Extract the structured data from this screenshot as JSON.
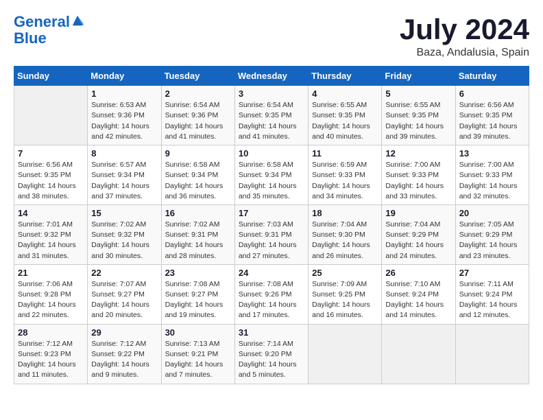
{
  "logo": {
    "line1": "General",
    "line2": "Blue"
  },
  "title": "July 2024",
  "subtitle": "Baza, Andalusia, Spain",
  "weekdays": [
    "Sunday",
    "Monday",
    "Tuesday",
    "Wednesday",
    "Thursday",
    "Friday",
    "Saturday"
  ],
  "weeks": [
    [
      {
        "day": "",
        "sunrise": "",
        "sunset": "",
        "daylight": ""
      },
      {
        "day": "1",
        "sunrise": "Sunrise: 6:53 AM",
        "sunset": "Sunset: 9:36 PM",
        "daylight": "Daylight: 14 hours and 42 minutes."
      },
      {
        "day": "2",
        "sunrise": "Sunrise: 6:54 AM",
        "sunset": "Sunset: 9:36 PM",
        "daylight": "Daylight: 14 hours and 41 minutes."
      },
      {
        "day": "3",
        "sunrise": "Sunrise: 6:54 AM",
        "sunset": "Sunset: 9:35 PM",
        "daylight": "Daylight: 14 hours and 41 minutes."
      },
      {
        "day": "4",
        "sunrise": "Sunrise: 6:55 AM",
        "sunset": "Sunset: 9:35 PM",
        "daylight": "Daylight: 14 hours and 40 minutes."
      },
      {
        "day": "5",
        "sunrise": "Sunrise: 6:55 AM",
        "sunset": "Sunset: 9:35 PM",
        "daylight": "Daylight: 14 hours and 39 minutes."
      },
      {
        "day": "6",
        "sunrise": "Sunrise: 6:56 AM",
        "sunset": "Sunset: 9:35 PM",
        "daylight": "Daylight: 14 hours and 39 minutes."
      }
    ],
    [
      {
        "day": "7",
        "sunrise": "Sunrise: 6:56 AM",
        "sunset": "Sunset: 9:35 PM",
        "daylight": "Daylight: 14 hours and 38 minutes."
      },
      {
        "day": "8",
        "sunrise": "Sunrise: 6:57 AM",
        "sunset": "Sunset: 9:34 PM",
        "daylight": "Daylight: 14 hours and 37 minutes."
      },
      {
        "day": "9",
        "sunrise": "Sunrise: 6:58 AM",
        "sunset": "Sunset: 9:34 PM",
        "daylight": "Daylight: 14 hours and 36 minutes."
      },
      {
        "day": "10",
        "sunrise": "Sunrise: 6:58 AM",
        "sunset": "Sunset: 9:34 PM",
        "daylight": "Daylight: 14 hours and 35 minutes."
      },
      {
        "day": "11",
        "sunrise": "Sunrise: 6:59 AM",
        "sunset": "Sunset: 9:33 PM",
        "daylight": "Daylight: 14 hours and 34 minutes."
      },
      {
        "day": "12",
        "sunrise": "Sunrise: 7:00 AM",
        "sunset": "Sunset: 9:33 PM",
        "daylight": "Daylight: 14 hours and 33 minutes."
      },
      {
        "day": "13",
        "sunrise": "Sunrise: 7:00 AM",
        "sunset": "Sunset: 9:33 PM",
        "daylight": "Daylight: 14 hours and 32 minutes."
      }
    ],
    [
      {
        "day": "14",
        "sunrise": "Sunrise: 7:01 AM",
        "sunset": "Sunset: 9:32 PM",
        "daylight": "Daylight: 14 hours and 31 minutes."
      },
      {
        "day": "15",
        "sunrise": "Sunrise: 7:02 AM",
        "sunset": "Sunset: 9:32 PM",
        "daylight": "Daylight: 14 hours and 30 minutes."
      },
      {
        "day": "16",
        "sunrise": "Sunrise: 7:02 AM",
        "sunset": "Sunset: 9:31 PM",
        "daylight": "Daylight: 14 hours and 28 minutes."
      },
      {
        "day": "17",
        "sunrise": "Sunrise: 7:03 AM",
        "sunset": "Sunset: 9:31 PM",
        "daylight": "Daylight: 14 hours and 27 minutes."
      },
      {
        "day": "18",
        "sunrise": "Sunrise: 7:04 AM",
        "sunset": "Sunset: 9:30 PM",
        "daylight": "Daylight: 14 hours and 26 minutes."
      },
      {
        "day": "19",
        "sunrise": "Sunrise: 7:04 AM",
        "sunset": "Sunset: 9:29 PM",
        "daylight": "Daylight: 14 hours and 24 minutes."
      },
      {
        "day": "20",
        "sunrise": "Sunrise: 7:05 AM",
        "sunset": "Sunset: 9:29 PM",
        "daylight": "Daylight: 14 hours and 23 minutes."
      }
    ],
    [
      {
        "day": "21",
        "sunrise": "Sunrise: 7:06 AM",
        "sunset": "Sunset: 9:28 PM",
        "daylight": "Daylight: 14 hours and 22 minutes."
      },
      {
        "day": "22",
        "sunrise": "Sunrise: 7:07 AM",
        "sunset": "Sunset: 9:27 PM",
        "daylight": "Daylight: 14 hours and 20 minutes."
      },
      {
        "day": "23",
        "sunrise": "Sunrise: 7:08 AM",
        "sunset": "Sunset: 9:27 PM",
        "daylight": "Daylight: 14 hours and 19 minutes."
      },
      {
        "day": "24",
        "sunrise": "Sunrise: 7:08 AM",
        "sunset": "Sunset: 9:26 PM",
        "daylight": "Daylight: 14 hours and 17 minutes."
      },
      {
        "day": "25",
        "sunrise": "Sunrise: 7:09 AM",
        "sunset": "Sunset: 9:25 PM",
        "daylight": "Daylight: 14 hours and 16 minutes."
      },
      {
        "day": "26",
        "sunrise": "Sunrise: 7:10 AM",
        "sunset": "Sunset: 9:24 PM",
        "daylight": "Daylight: 14 hours and 14 minutes."
      },
      {
        "day": "27",
        "sunrise": "Sunrise: 7:11 AM",
        "sunset": "Sunset: 9:24 PM",
        "daylight": "Daylight: 14 hours and 12 minutes."
      }
    ],
    [
      {
        "day": "28",
        "sunrise": "Sunrise: 7:12 AM",
        "sunset": "Sunset: 9:23 PM",
        "daylight": "Daylight: 14 hours and 11 minutes."
      },
      {
        "day": "29",
        "sunrise": "Sunrise: 7:12 AM",
        "sunset": "Sunset: 9:22 PM",
        "daylight": "Daylight: 14 hours and 9 minutes."
      },
      {
        "day": "30",
        "sunrise": "Sunrise: 7:13 AM",
        "sunset": "Sunset: 9:21 PM",
        "daylight": "Daylight: 14 hours and 7 minutes."
      },
      {
        "day": "31",
        "sunrise": "Sunrise: 7:14 AM",
        "sunset": "Sunset: 9:20 PM",
        "daylight": "Daylight: 14 hours and 5 minutes."
      },
      {
        "day": "",
        "sunrise": "",
        "sunset": "",
        "daylight": ""
      },
      {
        "day": "",
        "sunrise": "",
        "sunset": "",
        "daylight": ""
      },
      {
        "day": "",
        "sunrise": "",
        "sunset": "",
        "daylight": ""
      }
    ]
  ]
}
